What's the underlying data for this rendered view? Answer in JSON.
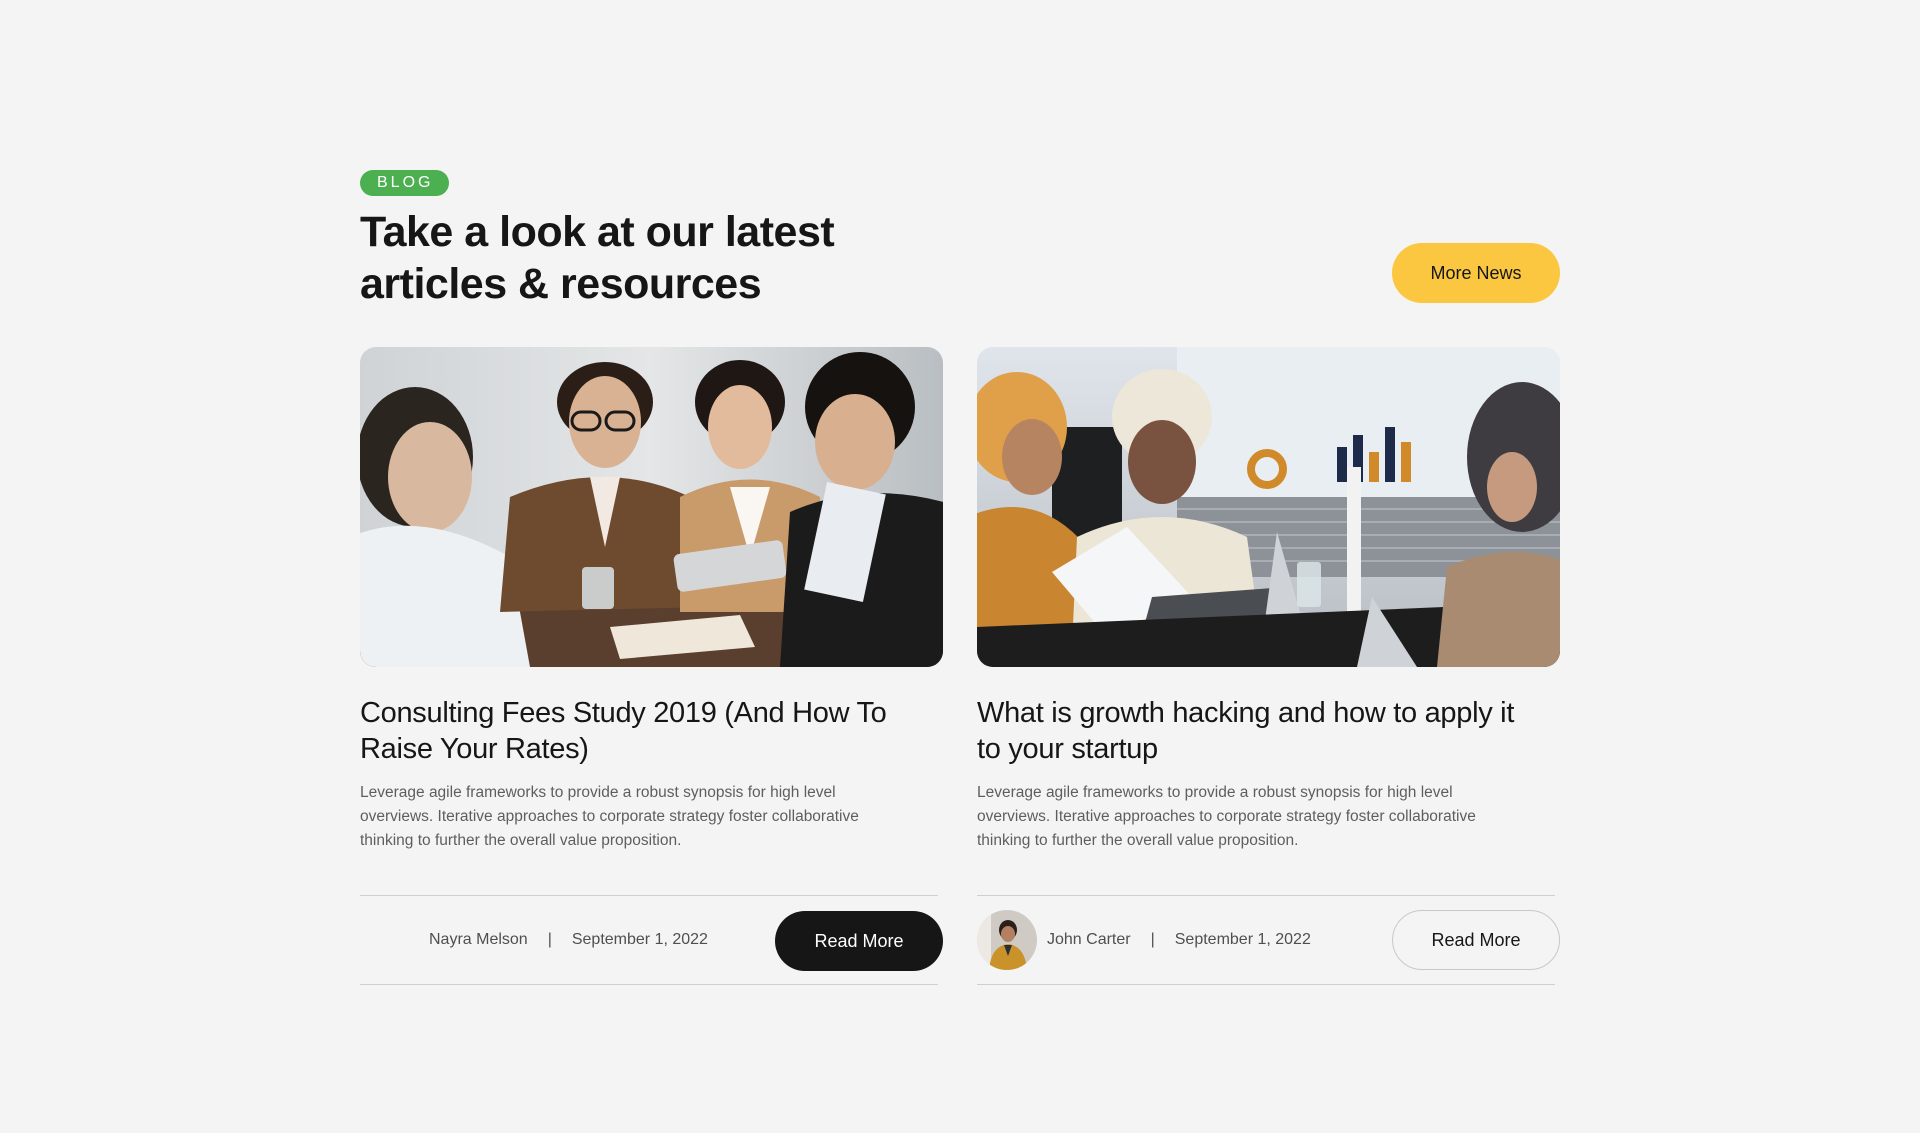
{
  "colors": {
    "background": "#f4f4f4",
    "badge": "#4caf50",
    "accent": "#fbc740",
    "dark_button": "#161616",
    "text": "#161616",
    "muted_text": "#5e5e5e"
  },
  "header": {
    "badge": "BLOG",
    "title_line1": "Take a look at our latest",
    "title_line2": "articles & resources",
    "more_news_label": "More News"
  },
  "cards": [
    {
      "image": "meeting-photo",
      "title_line1": "Consulting Fees Study 2019 (And How To",
      "title_line2": "Raise Your Rates)",
      "excerpt": "Leverage agile frameworks to provide a robust synopsis for high level overviews. Iterative approaches to corporate strategy foster collaborative thinking to further the overall value proposition.",
      "author": "Nayra Melson",
      "separator": "|",
      "date": "September 1, 2022",
      "read_more_label": "Read More"
    },
    {
      "image": "office-meeting-photo",
      "title_line1": "What is growth hacking and how to apply it",
      "title_line2": "to your startup",
      "excerpt": "Leverage agile frameworks to provide a robust synopsis for high level overviews. Iterative approaches to corporate strategy foster collaborative thinking to further the overall value proposition.",
      "author": "John Carter",
      "separator": "|",
      "date": "September 1, 2022",
      "read_more_label": "Read More"
    }
  ]
}
